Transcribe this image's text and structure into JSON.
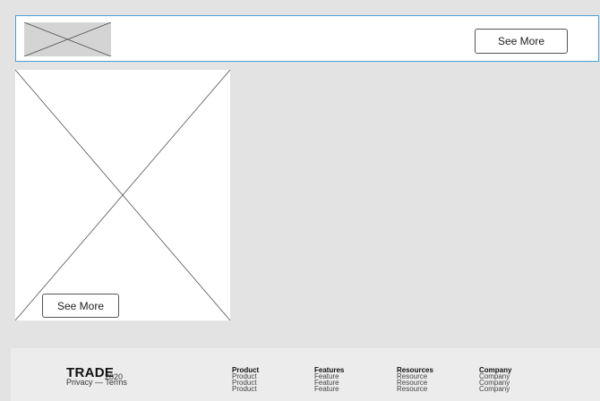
{
  "header": {
    "logo_icon": "image-placeholder-icon",
    "see_more_label": "See More"
  },
  "card": {
    "image_icon": "image-placeholder-icon",
    "see_more_label": "See More"
  },
  "footer": {
    "brand": "TRADE",
    "copyright": "2020",
    "legal": "Privacy — Terms",
    "columns": [
      {
        "heading": "Product",
        "items": [
          "Product",
          "Product",
          "Product"
        ]
      },
      {
        "heading": "Features",
        "items": [
          "Feature",
          "Feature",
          "Feature"
        ]
      },
      {
        "heading": "Resources",
        "items": [
          "Resource",
          "Resource",
          "Resource"
        ]
      },
      {
        "heading": "Company",
        "items": [
          "Company",
          "Company",
          "Company"
        ]
      }
    ]
  },
  "colors": {
    "background": "#e3e3e3",
    "header_border": "#4a9fd8",
    "placeholder": "#d4d4d4",
    "footer": "#ececec"
  }
}
